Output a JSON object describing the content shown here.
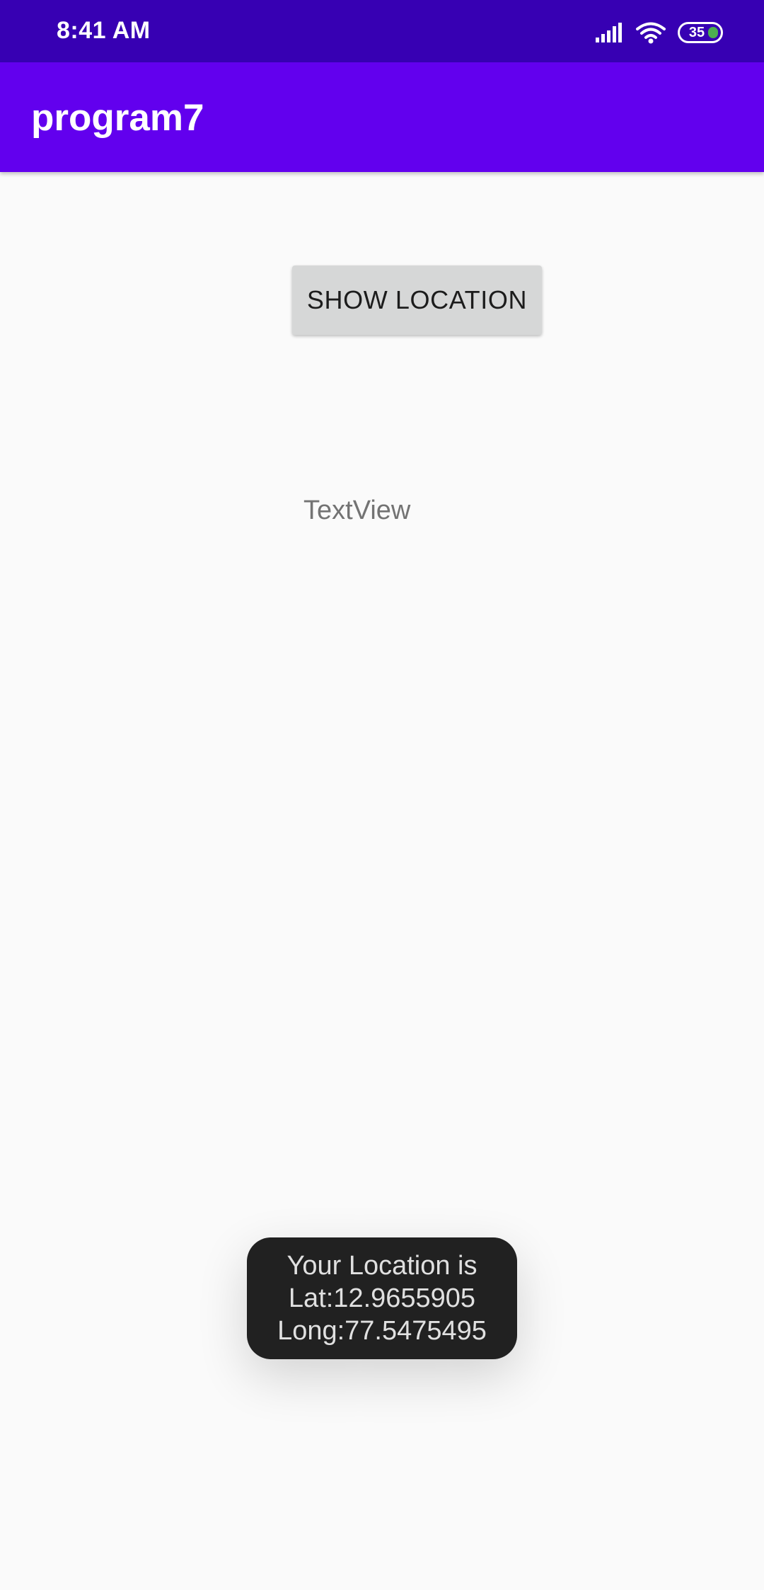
{
  "status_bar": {
    "time": "8:41 AM",
    "battery_level": "35",
    "icons": [
      "signal-icon",
      "wifi-icon",
      "battery-icon"
    ]
  },
  "app_bar": {
    "title": "program7"
  },
  "main": {
    "show_location_button": "SHOW LOCATION",
    "text_view": "TextView"
  },
  "toast": {
    "line1": "Your Location is",
    "line2": "Lat:12.9655905",
    "line3": "Long:77.5475495"
  },
  "colors": {
    "status_bar": "#3700b3",
    "app_bar": "#6200ee",
    "background": "#fafafa",
    "button": "#d6d7d7",
    "toast": "#212121"
  }
}
